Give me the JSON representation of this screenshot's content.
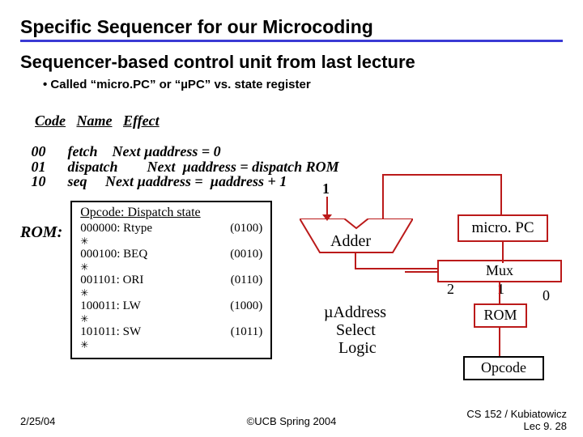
{
  "title": "Specific Sequencer for our Microcoding",
  "subtitle": "Sequencer-based control unit from last lecture",
  "bullet": "Called  “micro.PC” or “µPC” vs. state register",
  "codetable": {
    "hdr_code": "Code",
    "hdr_name": "Name",
    "hdr_effect": "Effect",
    "rows": [
      {
        "code": "00",
        "name": "fetch",
        "effect": "Next µaddress = 0"
      },
      {
        "code": "01",
        "name": "dispatch",
        "effect": "Next  µaddress = dispatch ROM"
      },
      {
        "code": "10",
        "name": "seq",
        "effect": "Next µaddress =  µaddress + 1"
      }
    ]
  },
  "rom": {
    "label": "ROM:",
    "header": "Opcode: Dispatch state",
    "rows": [
      {
        "op": "000000: Rtype",
        "state": "(0100)"
      },
      {
        "op": "000100: BEQ",
        "state": "(0010)"
      },
      {
        "op": "001101: ORI",
        "state": "(0110)"
      },
      {
        "op": "100011: LW",
        "state": "(1000)"
      },
      {
        "op": "101011: SW",
        "state": "(1011)"
      }
    ]
  },
  "diagram": {
    "one": "1",
    "adder": "Adder",
    "micropc": "micro. PC",
    "mux": "Mux",
    "two": "2",
    "one2": "1",
    "zero": "0",
    "rom": "ROM",
    "logic1": "µAddress",
    "logic2": "Select",
    "logic3": "Logic",
    "opcode": "Opcode"
  },
  "footer": {
    "left": "2/25/04",
    "center": "©UCB Spring 2004",
    "right1": "CS 152 / Kubiatowicz",
    "right2": "Lec 9. 28"
  }
}
